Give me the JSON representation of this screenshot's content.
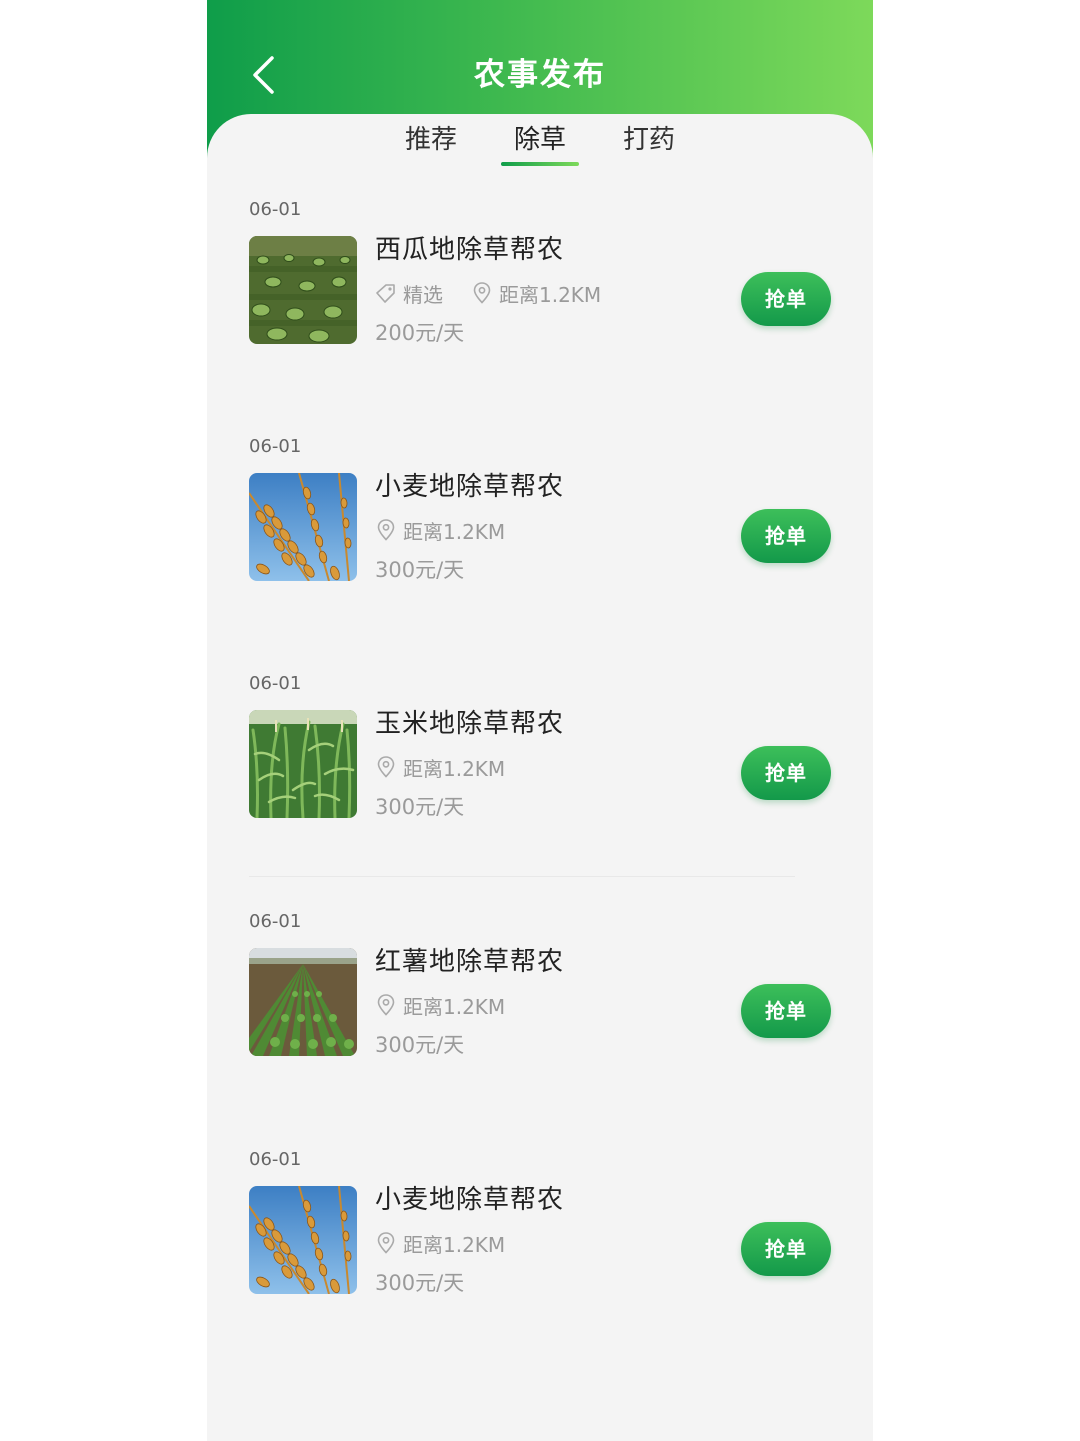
{
  "header": {
    "title": "农事发布",
    "back_icon": "chevron-left-icon"
  },
  "tabs": [
    {
      "label": "推荐",
      "active": false
    },
    {
      "label": "除草",
      "active": true
    },
    {
      "label": "打药",
      "active": false
    }
  ],
  "list": [
    {
      "date": "06-01",
      "title": "西瓜地除草帮农",
      "tag": "精选",
      "distance": "距离1.2KM",
      "price": "200元/天",
      "button": "抢单",
      "image": "watermelon-field"
    },
    {
      "date": "06-01",
      "title": "小麦地除草帮农",
      "distance": "距离1.2KM",
      "price": "300元/天",
      "button": "抢单",
      "image": "wheat"
    },
    {
      "date": "06-01",
      "title": "玉米地除草帮农",
      "distance": "距离1.2KM",
      "price": "300元/天",
      "button": "抢单",
      "image": "corn-field"
    },
    {
      "date": "06-01",
      "title": "红薯地除草帮农",
      "distance": "距离1.2KM",
      "price": "300元/天",
      "button": "抢单",
      "image": "sweet-potato-field"
    },
    {
      "date": "06-01",
      "title": "小麦地除草帮农",
      "distance": "距离1.2KM",
      "price": "300元/天",
      "button": "抢单",
      "image": "wheat"
    }
  ],
  "colors": {
    "header_start": "#0f9d4a",
    "header_end": "#7dd95a",
    "button": "#13994a",
    "background": "#f4f4f4"
  }
}
